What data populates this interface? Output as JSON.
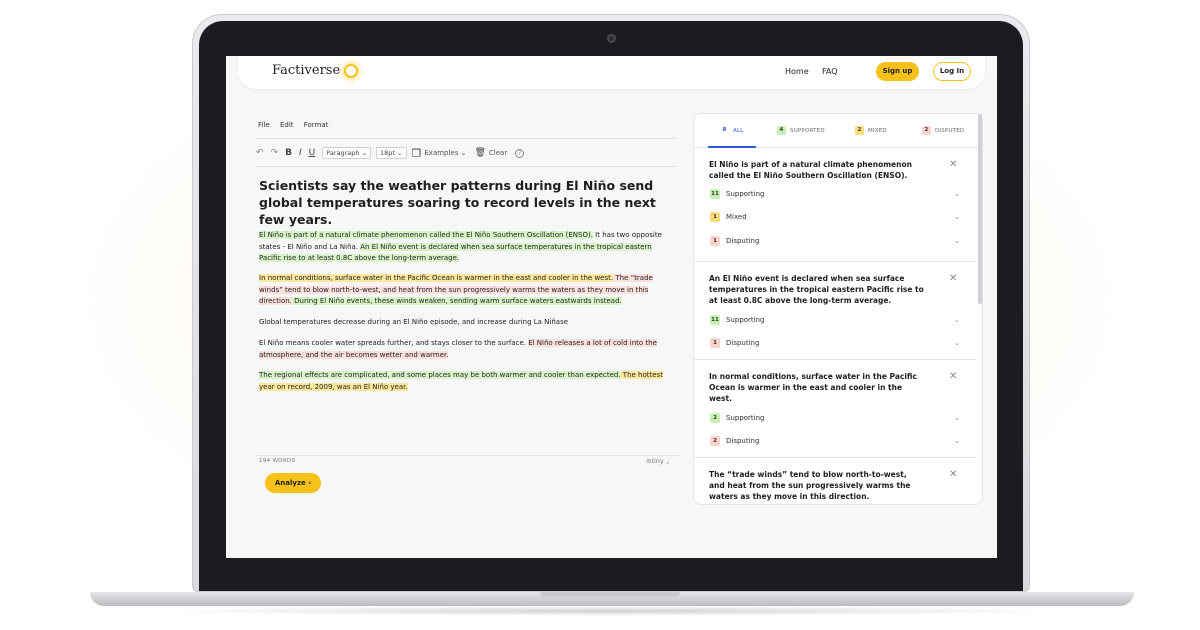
{
  "nav": {
    "logo": "Factiverse",
    "home": "Home",
    "faq": "FAQ",
    "signup": "Sign up",
    "login": "Log In"
  },
  "editor": {
    "menu": [
      "File",
      "Edit",
      "Format"
    ],
    "toolbar": {
      "paragraph": "Paragraph ⌄",
      "size": "18pt ⌄",
      "examples": "Examples ⌄",
      "clear": "Clear"
    },
    "title": "Scientists say the weather patterns during El Niño send global temperatures soaring to record levels in the next few years.",
    "p1": {
      "a": "El Niño is part of a natural climate phenomenon called the El Niño Southern Oscillation (ENSO).",
      "b": " It has two opposite states - El Niño and La Niña. ",
      "c": "An El Niño event is declared when sea surface temperatures in the tropical eastern Pacific rise to at least 0.8C above the long-term average."
    },
    "p2": {
      "a": "In normal conditions, surface water in the Pacific Ocean is warmer in the east and cooler in the west.",
      "b": " The “trade winds” tend to blow north-to-west, and heat from the sun progressively warms the waters as they move in this direction.",
      "c": " During El Niño events, these winds weaken, sending warm surface waters eastwards instead."
    },
    "p3": "Global temperatures decrease during an El Niño episode, and increase during La Niñase",
    "p4": {
      "a": "El Niño means cooler water spreads further, and stays closer to the surface. ",
      "b": "El Niño releases a lot of cold into the atmosphere, and the air becomes wetter and warmer."
    },
    "p5": {
      "a": "The regional effects are complicated, and some places may be both warmer and cooler than expected.",
      "b": " The hottest year on record, 2009, was an El Niño year."
    },
    "word_count": "194 WORDS",
    "tiny": "tiny",
    "analyze": "Analyze"
  },
  "results": {
    "tabs": [
      {
        "count": "8",
        "label": "ALL"
      },
      {
        "count": "4",
        "label": "SUPPORTED"
      },
      {
        "count": "2",
        "label": "MIXED"
      },
      {
        "count": "2",
        "label": "DISPUTED"
      }
    ],
    "cards": [
      {
        "claim": "El Niño is part of a natural climate phenomenon called the El Niño Southern Oscillation (ENSO).",
        "rows": [
          {
            "count": "11",
            "label": "Supporting"
          },
          {
            "count": "1",
            "label": "Mixed"
          },
          {
            "count": "1",
            "label": "Disputing"
          }
        ]
      },
      {
        "claim": "An El Niño event is declared when sea surface temperatures in the tropical eastern Pacific rise to at least 0.8C above the long-term average.",
        "rows": [
          {
            "count": "11",
            "label": "Supporting"
          },
          {
            "count": "1",
            "label": "Disputing"
          }
        ]
      },
      {
        "claim": "In normal conditions, surface water in the Pacific Ocean is warmer in the east and cooler in the west.",
        "rows": [
          {
            "count": "2",
            "label": "Supporting"
          },
          {
            "count": "2",
            "label": "Disputing"
          }
        ]
      },
      {
        "claim": "The “trade winds” tend to blow north-to-west, and heat from the sun progressively warms the waters as they move in this direction."
      }
    ]
  },
  "colors": {
    "accent": "#f6c21a",
    "supported": "#d9f5c8",
    "mixed": "#fce89a",
    "disputed": "#fbe0db"
  }
}
